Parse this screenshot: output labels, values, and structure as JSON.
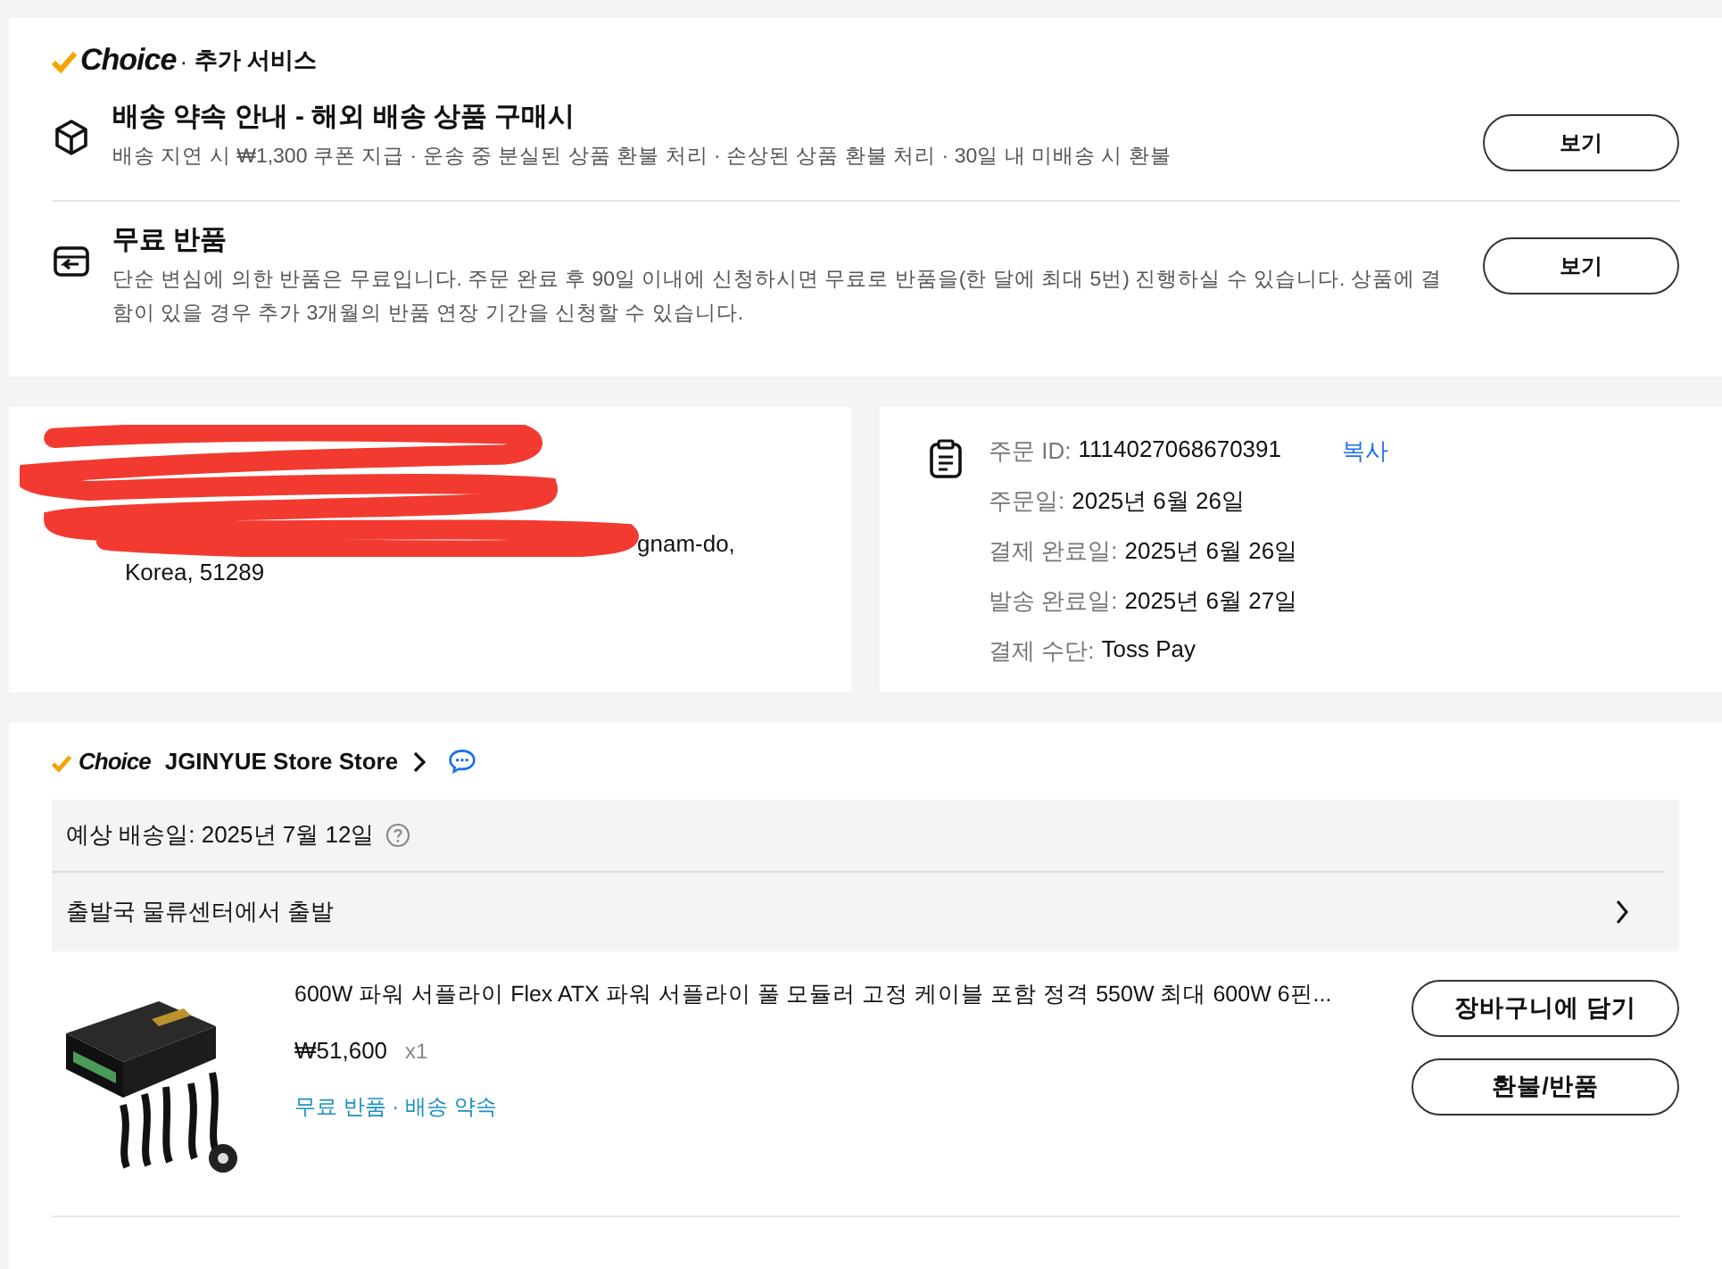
{
  "services": {
    "brand": "Choice",
    "separator": "·",
    "title": "추가 서비스",
    "items": [
      {
        "kind": "shipping",
        "title": "배송 약속 안내 - 해외 배송 상품 구매시",
        "description": "배송 지연 시 ₩1,300 쿠폰 지급 · 운송 중 분실된 상품 환불 처리 · 손상된 상품 환불 처리 · 30일 내 미배송 시 환불",
        "button": "보기"
      },
      {
        "kind": "return",
        "title": "무료 반품",
        "description": "단순 변심에 의한 반품은 무료입니다. 주문 완료 후 90일 이내에 신청하시면 무료로 반품을(한 달에 최대 5번) 진행하실 수 있습니다. 상품에 결함이 있을 경우 추가 3개월의 반품 연장 기간을 신청할 수 있습니다.",
        "button": "보기"
      }
    ]
  },
  "address": {
    "line_end": "gnam-do,",
    "last_line": "Korea, 51289"
  },
  "order_info": {
    "rows": [
      {
        "label": "주문 ID:",
        "value": "1114027068670391",
        "action": "복사"
      },
      {
        "label": "주문일:",
        "value": "2025년 6월 26일"
      },
      {
        "label": "결제 완료일:",
        "value": "2025년 6월 26일"
      },
      {
        "label": "발송 완료일:",
        "value": "2025년 6월 27일"
      },
      {
        "label": "결제 수단:",
        "value": "Toss Pay"
      }
    ]
  },
  "store": {
    "brand": "Choice",
    "name": "JGINYUE Store Store",
    "estimate_label": "예상 배송일:",
    "estimate_value": "2025년 7월 12일",
    "status": "출발국 물류센터에서 출발",
    "product": {
      "title": "600W 파워 서플라이 Flex ATX 파워 서플라이 풀 모듈러 고정 케이블 포함 정격 550W 최대 600W 6핀...",
      "price": "₩51,600",
      "quantity": "x1",
      "tags": "무료 반품 · 배송 약속",
      "buttons": [
        "장바구니에 담기",
        "환불/반품"
      ]
    }
  }
}
